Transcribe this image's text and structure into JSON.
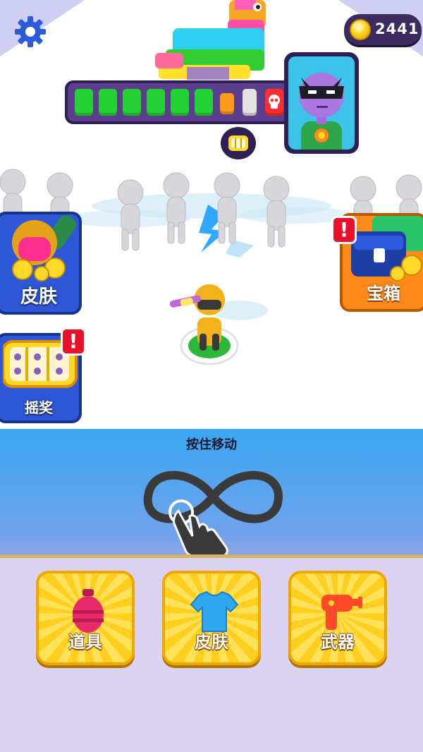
{
  "hud": {
    "coins": "2441",
    "boss_health_bar": {
      "filled_segments": 6,
      "total_segments": 9
    }
  },
  "side_buttons": {
    "skin_label": "皮肤",
    "chest_label": "宝箱",
    "lottery_label": "摇奖",
    "alert_mark": "!"
  },
  "tutorial": {
    "instruction": "按住移动"
  },
  "bottom_menu": {
    "items_label": "道具",
    "skins_label": "皮肤",
    "weapons_label": "武器"
  },
  "icons": [
    "gear-icon",
    "coin-icon",
    "skull-icon",
    "infinity-path-icon",
    "pointing-hand-icon",
    "grenade-icon",
    "tshirt-icon",
    "ray-gun-icon"
  ],
  "colors": {
    "accent_yellow": "#ffd92a",
    "health_green": "#25d236",
    "panel_blue": "#3aa6f0",
    "alert_red": "#e8102a"
  }
}
